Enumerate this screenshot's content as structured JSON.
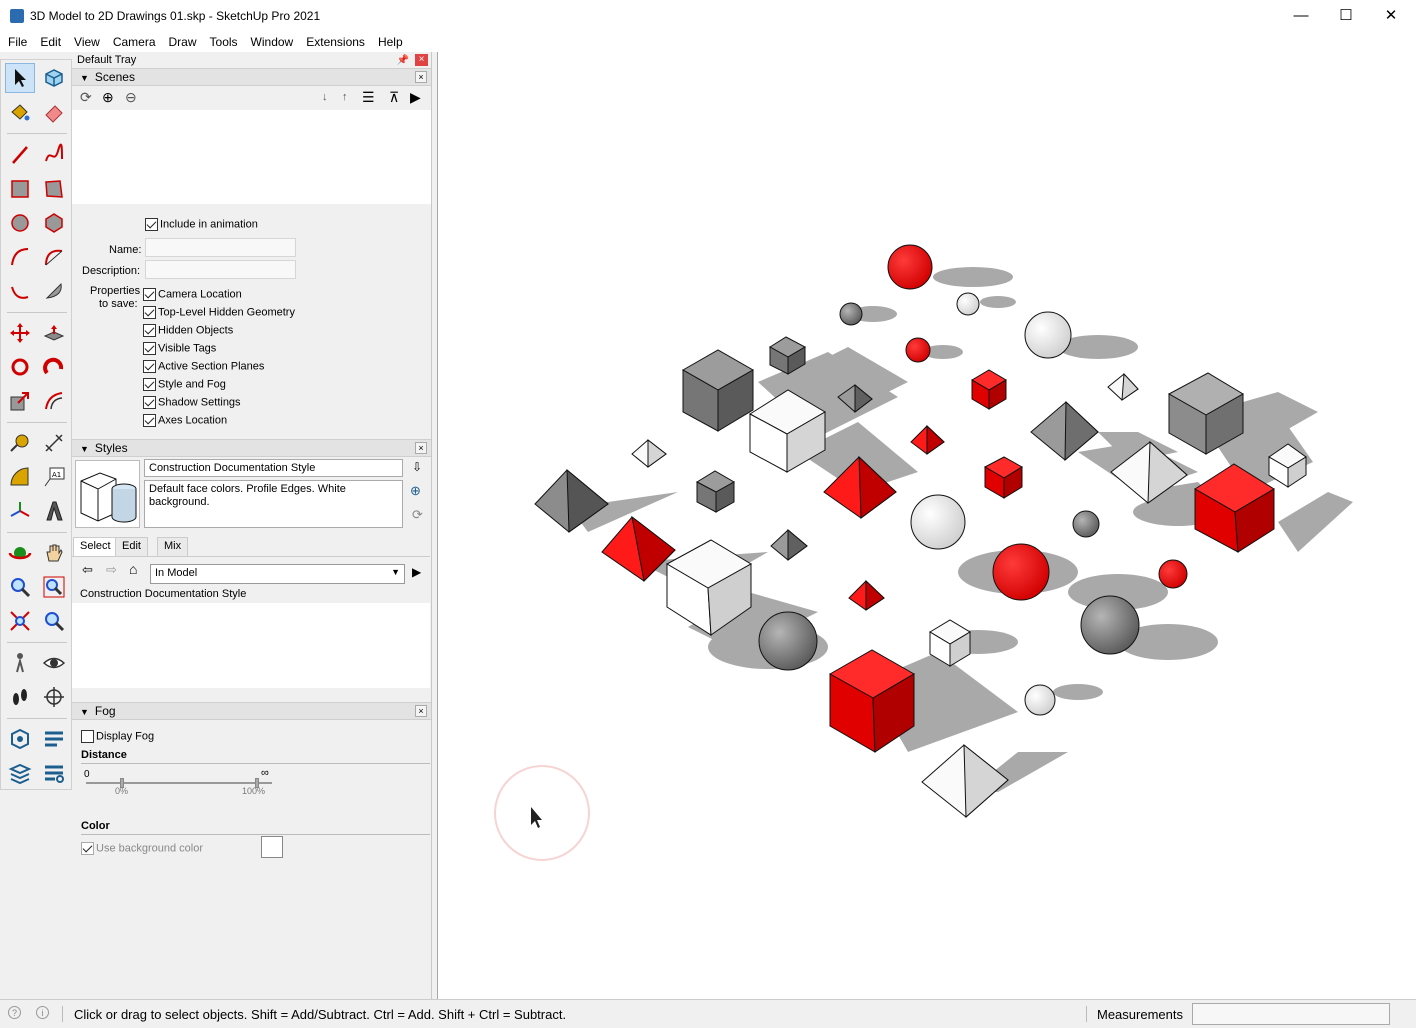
{
  "window": {
    "title": "3D Model to 2D Drawings 01.skp - SketchUp Pro 2021",
    "minimize": "—",
    "maximize": "☐",
    "close": "✕"
  },
  "menu": [
    "File",
    "Edit",
    "View",
    "Camera",
    "Draw",
    "Tools",
    "Window",
    "Extensions",
    "Help"
  ],
  "tray": {
    "title": "Default Tray",
    "scenes": {
      "header": "Scenes",
      "include_animation": "Include in animation",
      "name_label": "Name:",
      "description_label": "Description:",
      "properties_label_1": "Properties",
      "properties_label_2": "to save:",
      "properties": [
        "Camera Location",
        "Top-Level Hidden Geometry",
        "Hidden Objects",
        "Visible Tags",
        "Active Section Planes",
        "Style and Fog",
        "Shadow Settings",
        "Axes Location"
      ]
    },
    "styles": {
      "header": "Styles",
      "style_name": "Construction Documentation Style",
      "style_description": "Default face colors. Profile Edges. White background.",
      "tabs": [
        "Select",
        "Edit",
        "Mix"
      ],
      "dropdown": "In Model",
      "list_item": "Construction Documentation Style"
    },
    "fog": {
      "header": "Fog",
      "display_fog": "Display Fog",
      "distance": "Distance",
      "min": "0",
      "max": "∞",
      "pct0": "0%",
      "pct100": "100%",
      "color": "Color",
      "use_bg": "Use background color"
    }
  },
  "status": {
    "hint": "Click or drag to select objects. Shift = Add/Subtract. Ctrl = Add. Shift + Ctrl = Subtract.",
    "measurements": "Measurements"
  },
  "colors": {
    "red": "#ee0000",
    "gray": "#8c8c8c",
    "shadow": "#a9a9a9"
  }
}
